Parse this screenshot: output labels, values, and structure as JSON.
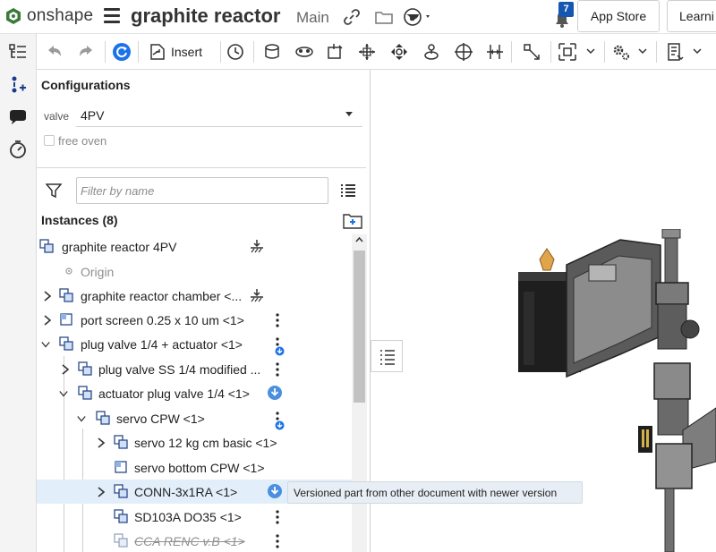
{
  "app": {
    "name": "onshape",
    "document_title": "graphite reactor",
    "branch": "Main",
    "notification_count": "7",
    "app_store_label": "App Store",
    "learning_label": "Learni"
  },
  "toolbar": {
    "insert_label": "Insert"
  },
  "configurations": {
    "title": "Configurations",
    "param_label": "valve",
    "param_value": "4PV",
    "checkbox_label": "free oven"
  },
  "instances": {
    "filter_placeholder": "Filter by name",
    "title": "Instances (8)",
    "rows": [
      {
        "label": "graphite reactor 4PV"
      },
      {
        "label": "Origin"
      },
      {
        "label": "graphite reactor chamber <..."
      },
      {
        "label": "port screen 0.25 x 10 um <1>"
      },
      {
        "label": "plug valve 1/4 + actuator <1>"
      },
      {
        "label": "plug valve SS 1/4 modified ..."
      },
      {
        "label": "actuator plug valve 1/4 <1>"
      },
      {
        "label": "servo CPW <1>"
      },
      {
        "label": "servo 12 kg cm basic <1>"
      },
      {
        "label": "servo bottom CPW <1>"
      },
      {
        "label": "CONN-3x1RA <1>"
      },
      {
        "label": "SD103A DO35 <1>"
      },
      {
        "label": "CCA RENC v.B <1>"
      }
    ]
  },
  "tooltip": {
    "text": "Versioned part from other document with newer version"
  },
  "colors": {
    "accent_blue": "#1a73e8",
    "selected_row": "#e3eefb",
    "badge_blue": "#1557b0"
  }
}
